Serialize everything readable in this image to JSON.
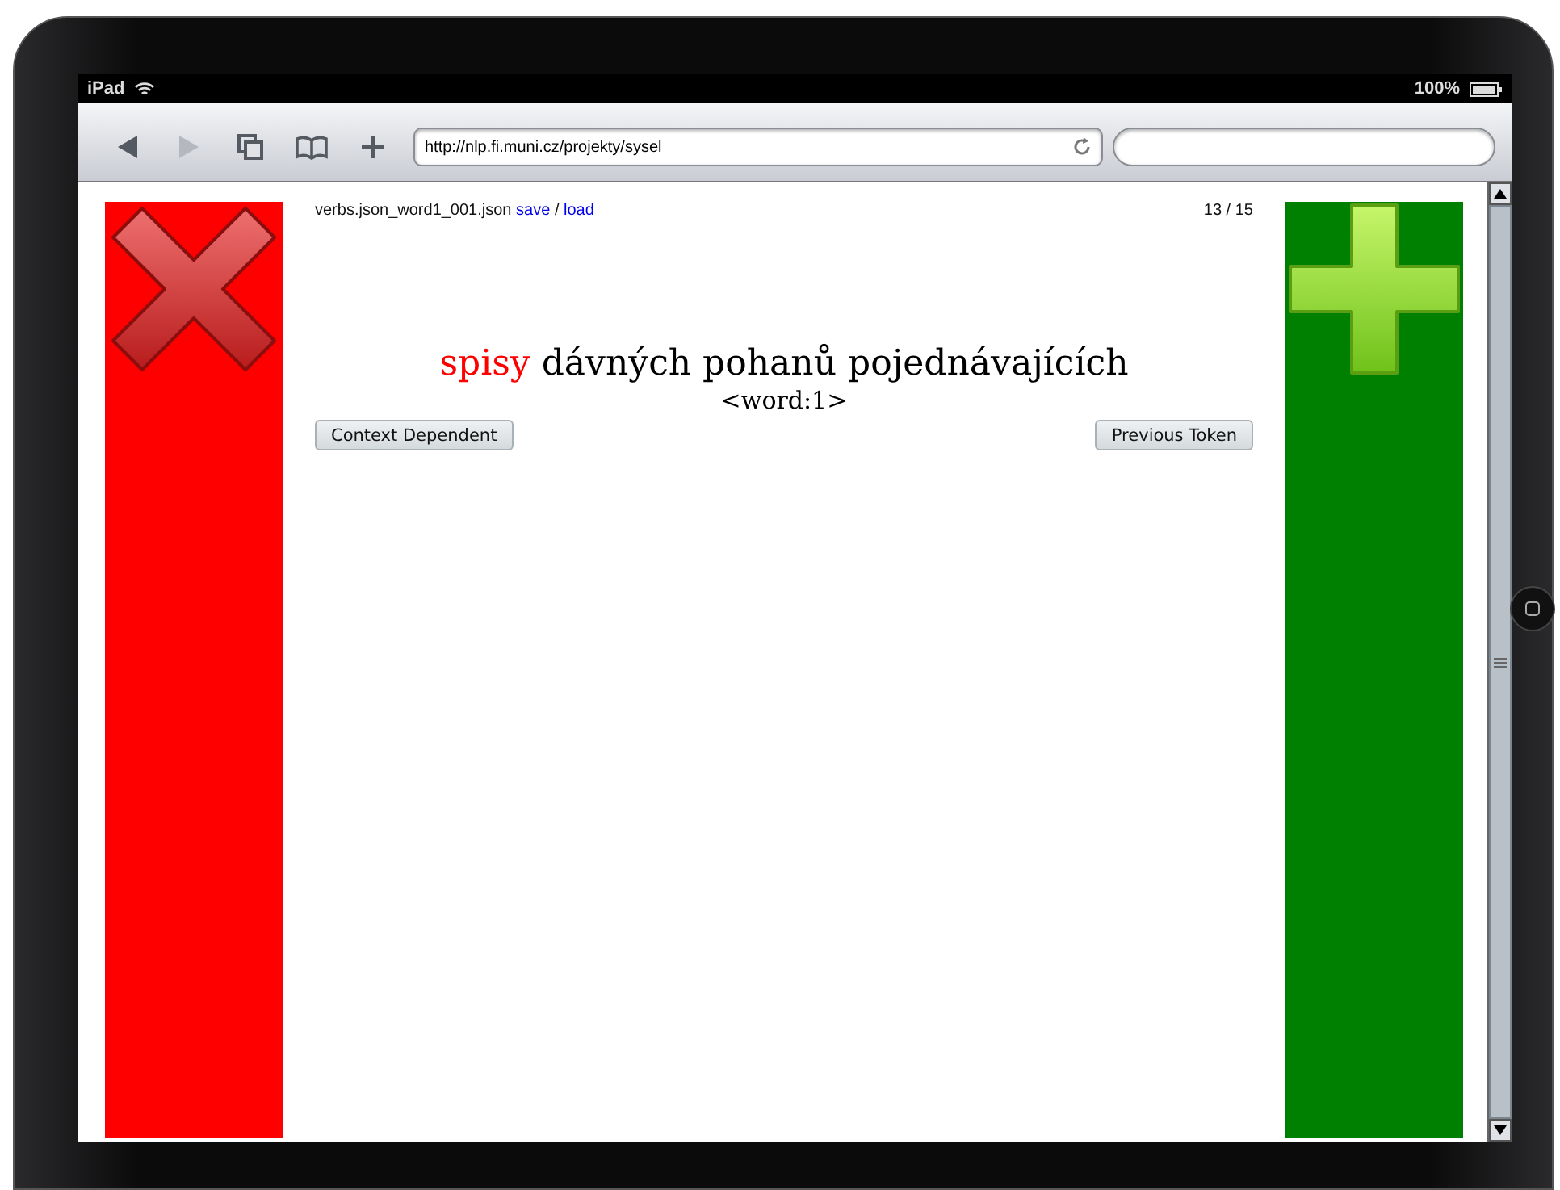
{
  "status_bar": {
    "device": "iPad",
    "battery": "100%"
  },
  "toolbar": {
    "back_disabled": false,
    "forward_disabled": true,
    "url": "http://nlp.fi.muni.cz/projekty/sysel"
  },
  "header": {
    "filename": "verbs.json_word1_001.json",
    "links": [
      {
        "label": "save"
      },
      {
        "label": "load"
      }
    ],
    "separator": "/",
    "counter": "13 / 15"
  },
  "sentence": [
    {
      "text": "spisy",
      "highlighted": true
    },
    {
      "text": "dávných pohanů pojednávajících",
      "highlighted": false
    }
  ],
  "tag": "<word:1>",
  "buttons": [
    {
      "label": "Context Dependent"
    },
    {
      "label": "Previous Token"
    }
  ]
}
